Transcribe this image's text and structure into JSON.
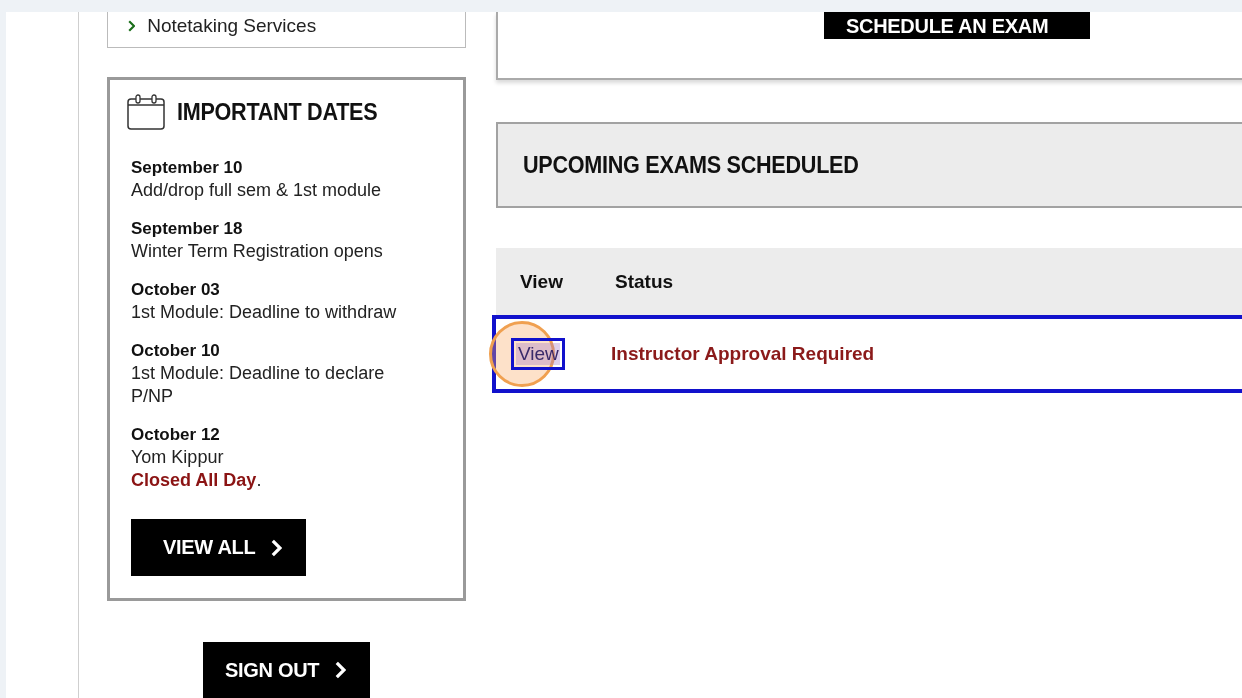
{
  "services_list": {
    "items": [
      {
        "label": "Notetaking Services"
      }
    ]
  },
  "important_dates": {
    "title": "IMPORTANT DATES",
    "entries": [
      {
        "date": "September 10",
        "description": "Add/drop full sem & 1st module"
      },
      {
        "date": "September 18",
        "description": "Winter Term Registration opens"
      },
      {
        "date": "October 03",
        "description": "1st Module: Deadline to withdraw"
      },
      {
        "date": "October 10",
        "description": "1st Module: Deadline to declare P/NP"
      },
      {
        "date": "October 12",
        "description": "Yom Kippur",
        "note": "**Closed All Day**."
      }
    ],
    "button": "VIEW ALL"
  },
  "sign_out_button": "SIGN OUT",
  "schedule_button": "SCHEDULE AN EXAM",
  "upcoming_exams": {
    "title": "UPCOMING EXAMS SCHEDULED",
    "columns": [
      "View",
      "Status"
    ],
    "rows": [
      {
        "view_link": "View",
        "status": "Instructor Approval Required",
        "highlighted": true,
        "click_marker": true
      }
    ]
  }
}
